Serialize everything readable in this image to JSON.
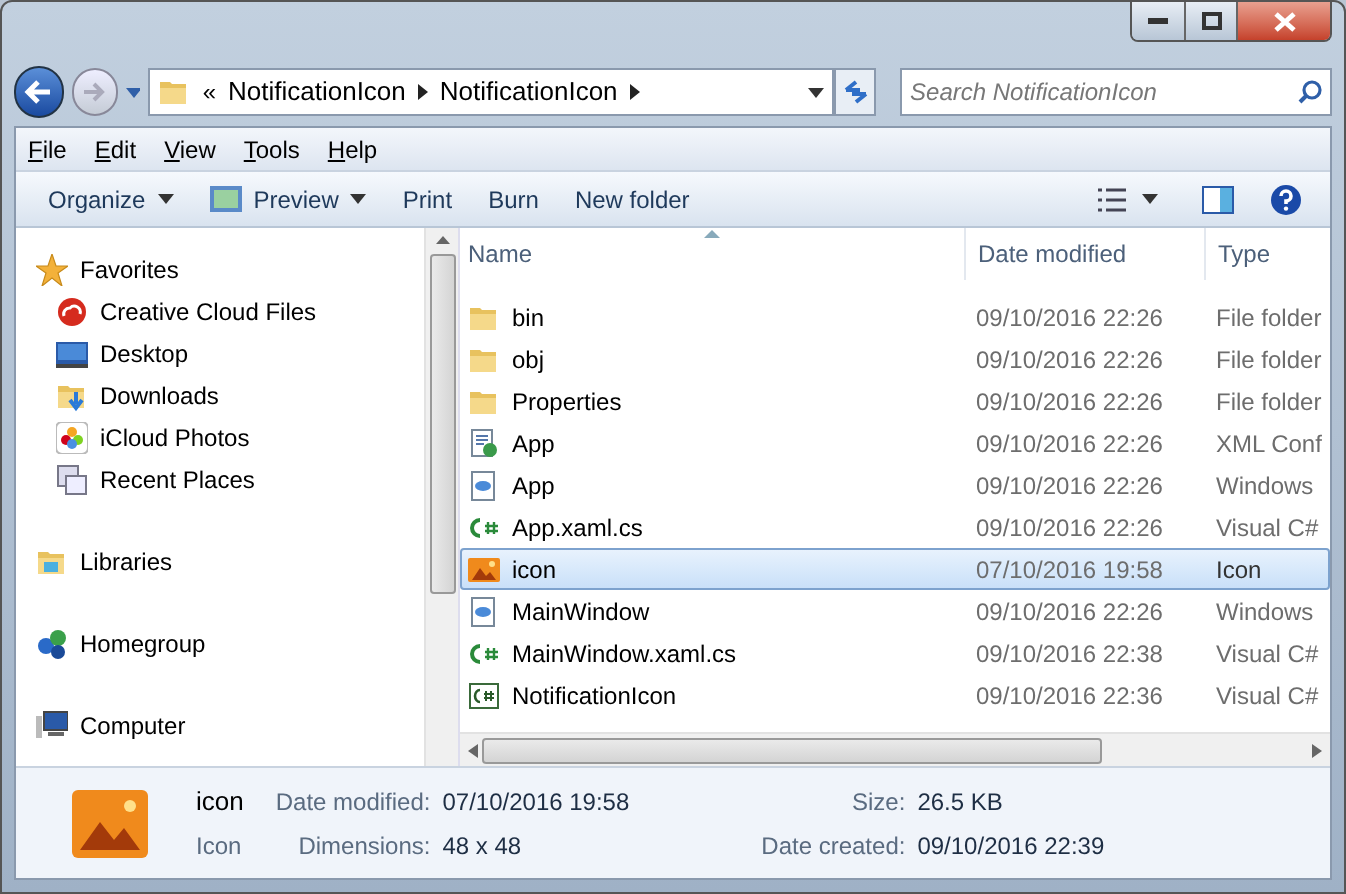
{
  "address_bar": {
    "overflow": "«",
    "segments": [
      "NotificationIcon",
      "NotificationIcon"
    ]
  },
  "search": {
    "placeholder": "Search NotificationIcon"
  },
  "menu": [
    "File",
    "Edit",
    "View",
    "Tools",
    "Help"
  ],
  "toolbar": [
    {
      "label": "Organize",
      "dropdown": true
    },
    {
      "label": "Preview",
      "dropdown": true
    },
    {
      "label": "Print",
      "dropdown": false
    },
    {
      "label": "Burn",
      "dropdown": false
    },
    {
      "label": "New folder",
      "dropdown": false
    }
  ],
  "sidebar": {
    "items": [
      {
        "label": "Favorites",
        "children": [
          {
            "label": "Creative Cloud Files"
          },
          {
            "label": "Desktop"
          },
          {
            "label": "Downloads"
          },
          {
            "label": "iCloud Photos"
          },
          {
            "label": "Recent Places"
          }
        ]
      },
      {
        "label": "Libraries"
      },
      {
        "label": "Homegroup"
      },
      {
        "label": "Computer"
      }
    ]
  },
  "table": {
    "columns": [
      "Name",
      "Date modified",
      "Type"
    ],
    "rows": [
      {
        "name": "bin",
        "date": "09/10/2016 22:26",
        "type": "File folder",
        "kind": "folder",
        "selected": false
      },
      {
        "name": "obj",
        "date": "09/10/2016 22:26",
        "type": "File folder",
        "kind": "folder",
        "selected": false
      },
      {
        "name": "Properties",
        "date": "09/10/2016 22:26",
        "type": "File folder",
        "kind": "folder",
        "selected": false
      },
      {
        "name": "App",
        "date": "09/10/2016 22:26",
        "type": "XML Conf",
        "kind": "config",
        "selected": false
      },
      {
        "name": "App",
        "date": "09/10/2016 22:26",
        "type": "Windows",
        "kind": "xaml",
        "selected": false
      },
      {
        "name": "App.xaml.cs",
        "date": "09/10/2016 22:26",
        "type": "Visual C#",
        "kind": "csharp",
        "selected": false
      },
      {
        "name": "icon",
        "date": "07/10/2016 19:58",
        "type": "Icon",
        "kind": "image",
        "selected": true
      },
      {
        "name": "MainWindow",
        "date": "09/10/2016 22:26",
        "type": "Windows",
        "kind": "xaml",
        "selected": false
      },
      {
        "name": "MainWindow.xaml.cs",
        "date": "09/10/2016 22:38",
        "type": "Visual C#",
        "kind": "csharp",
        "selected": false
      },
      {
        "name": "NotificationIcon",
        "date": "09/10/2016 22:36",
        "type": "Visual C#",
        "kind": "csproj",
        "selected": false
      }
    ]
  },
  "details": {
    "name": "icon",
    "type": "Icon",
    "fields": [
      {
        "label": "Date modified:",
        "value": "07/10/2016 19:58"
      },
      {
        "label": "Size:",
        "value": "26.5 KB"
      },
      {
        "label": "Dimensions:",
        "value": "48 x 48"
      },
      {
        "label": "Date created:",
        "value": "09/10/2016 22:39"
      }
    ]
  }
}
